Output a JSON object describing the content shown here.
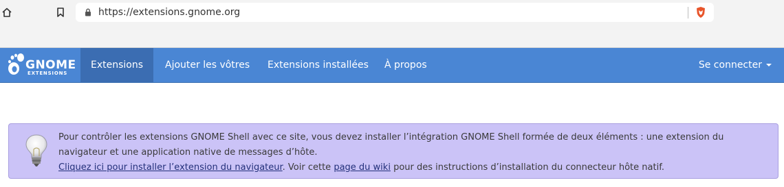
{
  "browser": {
    "url": "https://extensions.gnome.org",
    "icons": {
      "home": "home-icon",
      "bookmark": "bookmark-icon",
      "lock": "lock-icon",
      "brave": "brave-shield-icon"
    }
  },
  "nav": {
    "logo_main": "GNOME",
    "logo_sub": "EXTENSIONS",
    "items": [
      {
        "label": "Extensions",
        "active": true
      },
      {
        "label": "Ajouter les vôtres",
        "active": false
      },
      {
        "label": "Extensions installées",
        "active": false
      },
      {
        "label": "À propos",
        "active": false
      }
    ],
    "login_label": "Se connecter",
    "colors": {
      "bar": "#4a86d4",
      "active": "#3b6db2"
    }
  },
  "alert": {
    "line1": "Pour contrôler les extensions GNOME Shell avec ce site, vous devez installer l’intégration GNOME Shell formée de deux éléments : une extension du navigateur et une application native de messages d’hôte.",
    "link1": "Cliquez ici pour installer l’extension du navigateur",
    "mid": ". Voir cette ",
    "link2": "page du wiki",
    "tail": " pour des instructions d’installation du connecteur hôte natif.",
    "background": "#cbc3f7",
    "icon": "lightbulb-icon"
  }
}
